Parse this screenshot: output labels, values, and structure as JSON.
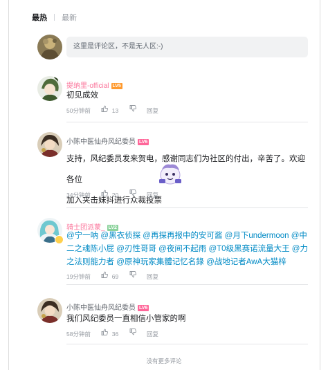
{
  "tabs": [
    {
      "label": "最热",
      "active": true
    },
    {
      "label": "最新",
      "active": false
    }
  ],
  "comment_input": {
    "placeholder": "这里是评论区，不是无人区:-)"
  },
  "comments": [
    {
      "username": "提纳里-official",
      "username_color": "#fb7299",
      "level": "LV5",
      "lines": [
        "初见成效"
      ],
      "time": "50分钟前",
      "likes": "13",
      "reply_label": "回复"
    },
    {
      "username": "小陈中医仙舟风纪委员",
      "username_color": "#61666d",
      "level": "LV6",
      "lines": [
        "支持，风纪委员发来贺电，感谢同志们为社区的付出，辛苦了。欢迎各位",
        "加入夹击妹抖进行众裁投票"
      ],
      "time": "34分钟前",
      "likes": "20",
      "reply_label": "回复"
    },
    {
      "username": "骑士团派蒙_",
      "username_color": "#fb7299",
      "level": "LV2",
      "mentions": [
        "@宁一呐",
        "@黑衣侦探",
        "@再探再报中的安可酱",
        "@月下undermoon",
        "@中二之魂陈小屁",
        "@刃性哥哥",
        "@夜间不起雨",
        "@T0级黑赛诺流量大王",
        "@力之法则能力者",
        "@原神玩家集體记忆名錄",
        "@战地记者AwA大猫梓"
      ],
      "time": "19分钟前",
      "likes": "69",
      "reply_label": "回复"
    },
    {
      "username": "小陈中医仙舟风纪委员",
      "username_color": "#61666d",
      "level": "LV6",
      "lines": [
        "我们风纪委员一直相信小管家的啊"
      ],
      "time": "58分钟前",
      "likes": "36",
      "reply_label": "回复"
    }
  ],
  "footer": "没有更多评论",
  "colors": {
    "accent_pink": "#fb7299",
    "mention_blue": "#008ac5",
    "meta_gray": "#9499a0"
  }
}
